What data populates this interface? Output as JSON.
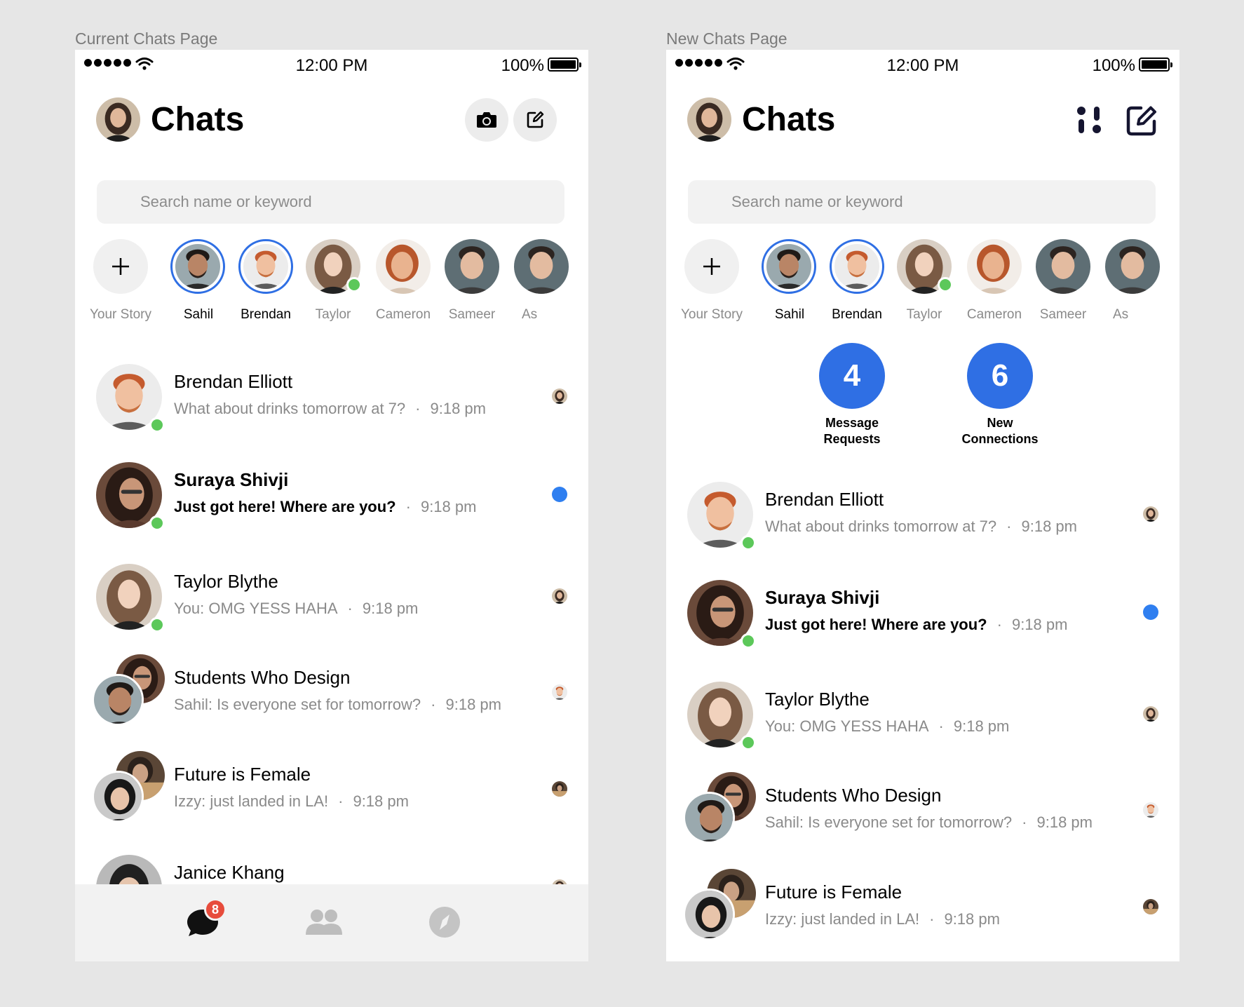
{
  "frames": {
    "left_label": "Current Chats Page",
    "right_label": "New Chats Page"
  },
  "status_bar": {
    "time": "12:00 PM",
    "battery": "100%"
  },
  "header": {
    "title": "Chats"
  },
  "search": {
    "placeholder": "Search name or keyword"
  },
  "stories": {
    "your_story": "Your Story",
    "items": [
      "Sahil",
      "Brendan",
      "Taylor",
      "Cameron",
      "Sameer",
      "As"
    ]
  },
  "counters": {
    "requests": {
      "count": "4",
      "label1": "Message",
      "label2": "Requests"
    },
    "connections": {
      "count": "6",
      "label1": "New",
      "label2": "Connections"
    }
  },
  "chats": [
    {
      "name": "Brendan Elliott",
      "message": "What about drinks tomorrow at 7?",
      "time": "9:18 pm"
    },
    {
      "name": "Suraya Shivji",
      "message": "Just got here! Where are you?",
      "time": "9:18 pm"
    },
    {
      "name": "Taylor Blythe",
      "message": "You: OMG YESS HAHA",
      "time": "9:18 pm"
    },
    {
      "name": "Students Who Design",
      "message": "Sahil: Is everyone set for tomorrow?",
      "time": "9:18 pm"
    },
    {
      "name": "Future is Female",
      "message": "Izzy: just landed in LA!",
      "time": "9:18 pm"
    },
    {
      "name": "Janice Khang"
    }
  ],
  "separator": "·",
  "bottom_nav": {
    "badge": "8"
  },
  "colors": {
    "accent": "#2f6fe4",
    "online": "#5cc85a",
    "unread": "#2f7ff0",
    "badge": "#e74c3c"
  },
  "icons": [
    "camera-icon",
    "compose-icon",
    "filter-icon",
    "plus-icon",
    "chat-bubble-icon",
    "people-icon",
    "compass-icon"
  ]
}
